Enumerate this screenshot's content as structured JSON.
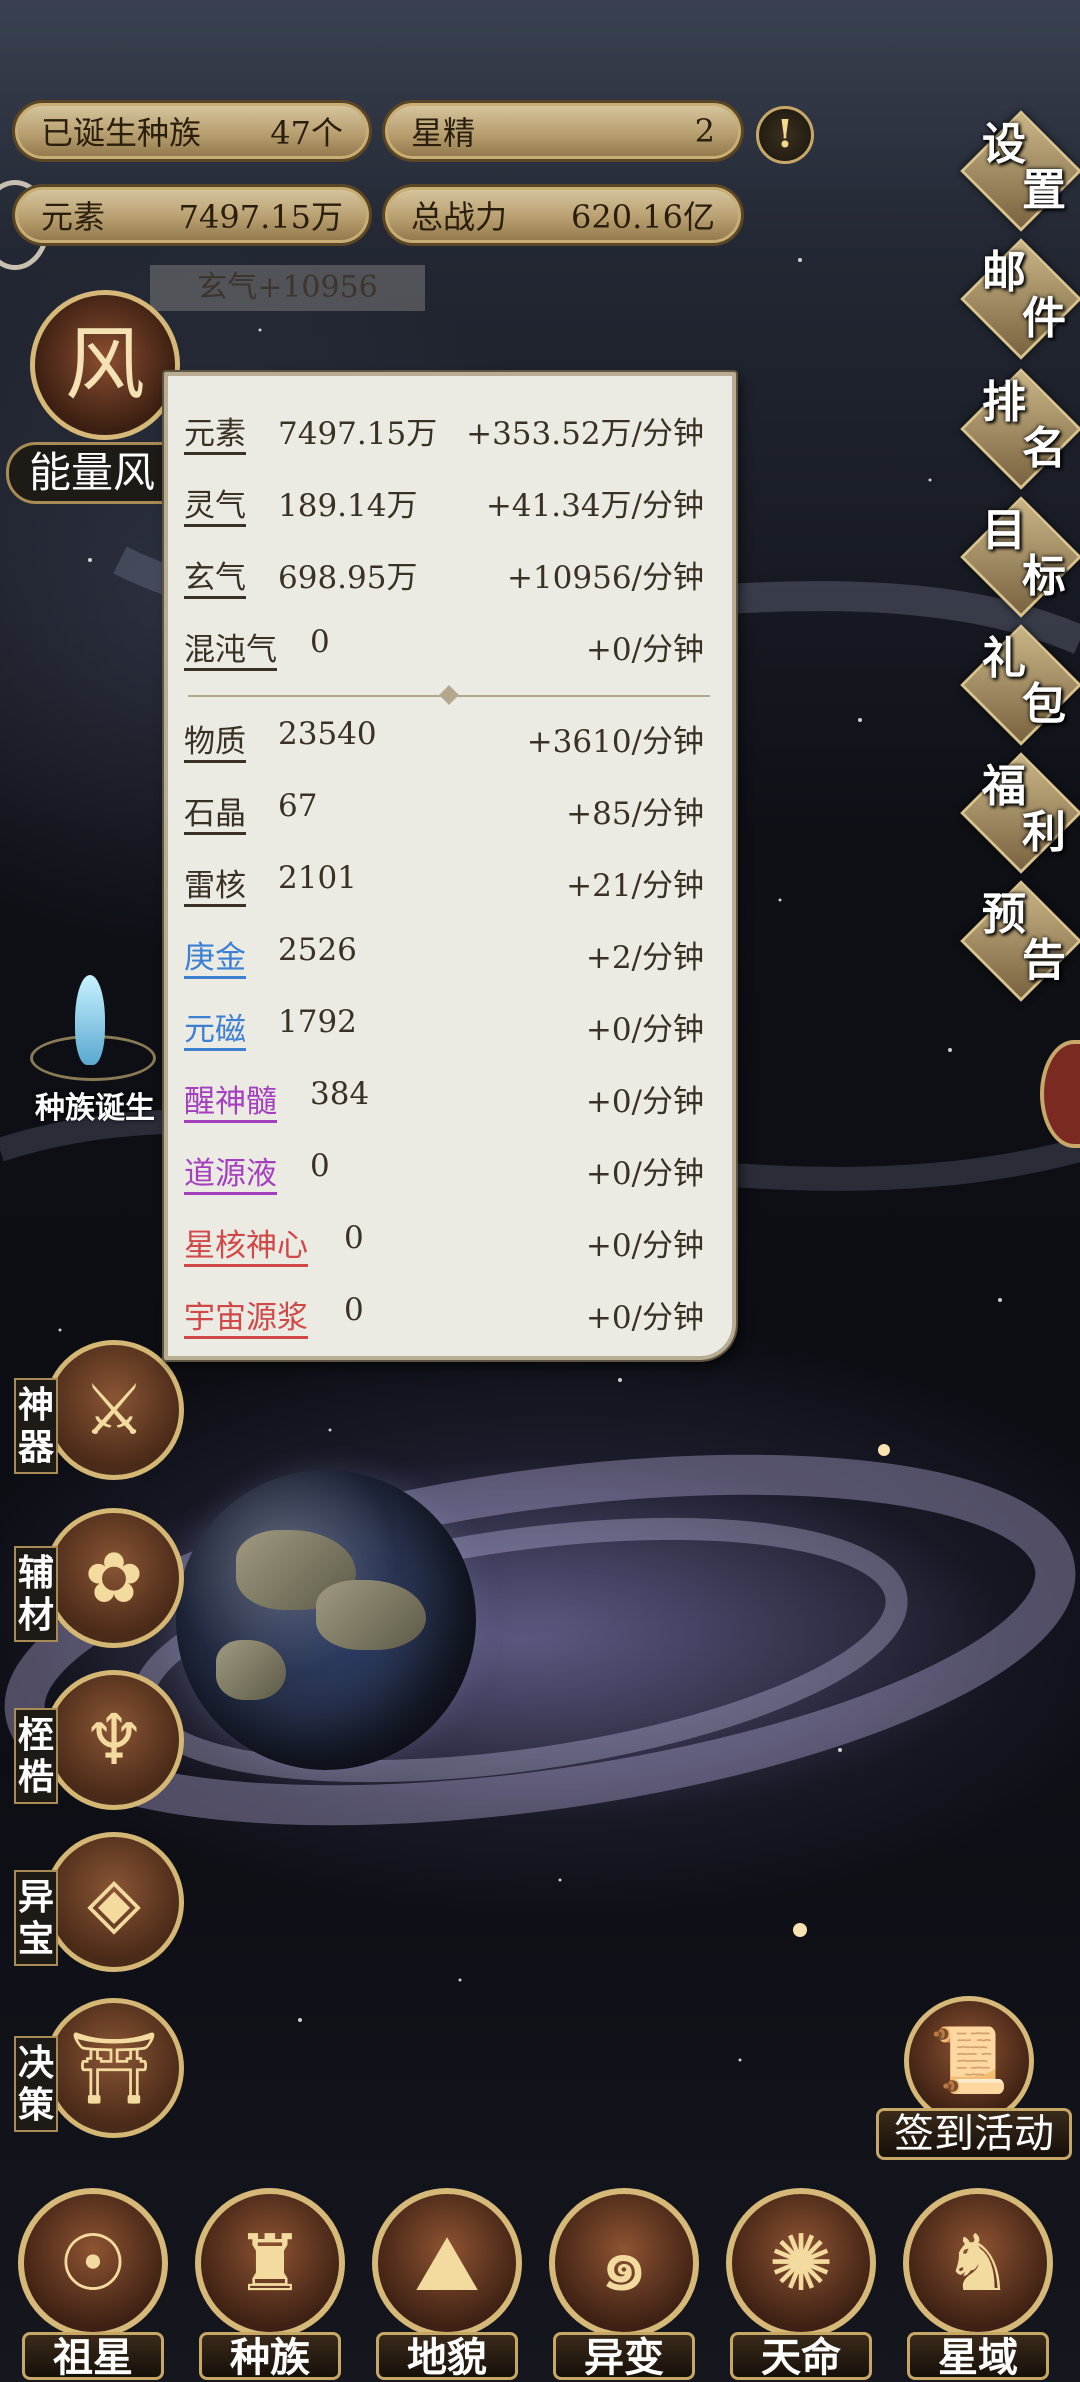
{
  "top_stats": {
    "species_born_label": "已诞生种族",
    "species_born_value": "47个",
    "star_essence_label": "星精",
    "star_essence_value": "2",
    "element_label": "元素",
    "element_value": "7497.15万",
    "total_power_label": "总战力",
    "total_power_value": "620.16亿",
    "alert_icon": "!"
  },
  "toast": "玄气+10956",
  "energy": {
    "label": "能量风"
  },
  "species_birth": {
    "label": "种族诞生"
  },
  "right_menu": [
    {
      "c1": "设",
      "c2": "置"
    },
    {
      "c1": "邮",
      "c2": "件"
    },
    {
      "c1": "排",
      "c2": "名"
    },
    {
      "c1": "目",
      "c2": "标"
    },
    {
      "c1": "礼",
      "c2": "包"
    },
    {
      "c1": "福",
      "c2": "利"
    },
    {
      "c1": "预",
      "c2": "告"
    }
  ],
  "left_menu": [
    {
      "label": "神器",
      "c1": "神",
      "c2": "器"
    },
    {
      "label": "辅材",
      "c1": "辅",
      "c2": "材"
    },
    {
      "label": "桎梏",
      "c1": "桎",
      "c2": "梏"
    },
    {
      "label": "异宝",
      "c1": "异",
      "c2": "宝"
    },
    {
      "label": "决策",
      "c1": "决",
      "c2": "策"
    }
  ],
  "sign_in": {
    "label": "签到活动"
  },
  "bottom_nav": [
    {
      "label": "祖星"
    },
    {
      "label": "种族"
    },
    {
      "label": "地貌"
    },
    {
      "label": "异变"
    },
    {
      "label": "天命"
    },
    {
      "label": "星域"
    }
  ],
  "resource_panel": {
    "rows": [
      {
        "name": "元素",
        "value": "7497.15万",
        "rate": "+353.52万/分钟",
        "color": "#3a3024"
      },
      {
        "name": "灵气",
        "value": "189.14万",
        "rate": "+41.34万/分钟",
        "color": "#3a3024"
      },
      {
        "name": "玄气",
        "value": "698.95万",
        "rate": "+10956/分钟",
        "color": "#3a3024"
      },
      {
        "name": "混沌气",
        "value": "0",
        "rate": "+0/分钟",
        "color": "#3a3024"
      },
      {
        "name": "物质",
        "value": "23540",
        "rate": "+3610/分钟",
        "color": "#3a3024"
      },
      {
        "name": "石晶",
        "value": "67",
        "rate": "+85/分钟",
        "color": "#3a3024"
      },
      {
        "name": "雷核",
        "value": "2101",
        "rate": "+21/分钟",
        "color": "#3a3024"
      },
      {
        "name": "庚金",
        "value": "2526",
        "rate": "+2/分钟",
        "color": "#3d7fd1"
      },
      {
        "name": "元磁",
        "value": "1792",
        "rate": "+0/分钟",
        "color": "#3d7fd1"
      },
      {
        "name": "醒神髓",
        "value": "384",
        "rate": "+0/分钟",
        "color": "#a43fc0"
      },
      {
        "name": "道源液",
        "value": "0",
        "rate": "+0/分钟",
        "color": "#a43fc0"
      },
      {
        "name": "星核神心",
        "value": "0",
        "rate": "+0/分钟",
        "color": "#d04848"
      },
      {
        "name": "宇宙源浆",
        "value": "0",
        "rate": "+0/分钟",
        "color": "#d04848"
      }
    ]
  }
}
